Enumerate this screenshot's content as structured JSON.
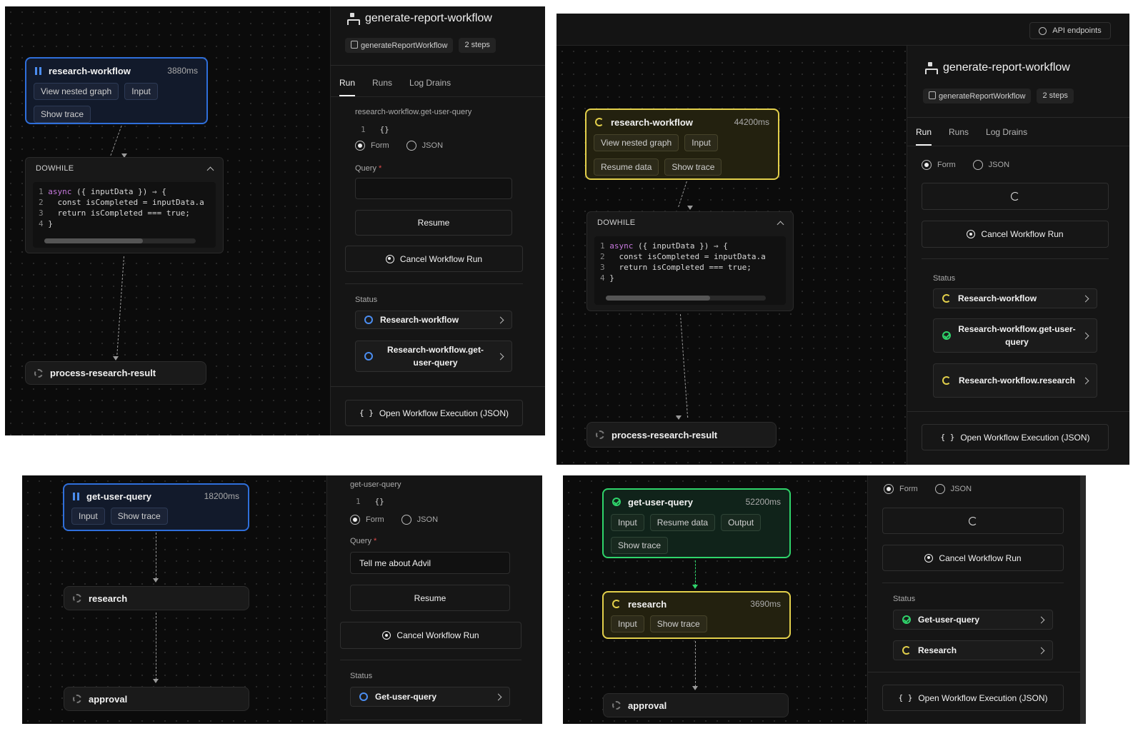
{
  "common": {
    "workflow_title": "generate-report-workflow",
    "workflow_id": "generateReportWorkflow",
    "steps": "2 steps",
    "tabs": [
      "Run",
      "Runs",
      "Log Drains"
    ],
    "form_label": "Form",
    "json_label": "JSON",
    "cancel_label": "Cancel Workflow Run",
    "status_label": "Status",
    "open_json_label": "Open Workflow Execution (JSON)",
    "resume_label": "Resume",
    "query_label": "Query",
    "required_mark": "*",
    "dowhile_label": "DOWHILE",
    "code_lines": [
      "async ({ inputData }) ⇒ {",
      "  const isCompleted = inputData.a",
      "  return isCompleted === true;",
      "}"
    ],
    "chip_view_nested": "View nested graph",
    "chip_input": "Input",
    "chip_show_trace": "Show trace",
    "chip_resume_data": "Resume data",
    "chip_output": "Output",
    "empty_json": "{}",
    "line_one": "1"
  },
  "p1": {
    "node_research": {
      "title": "research-workflow",
      "time": "3880ms"
    },
    "node_process": {
      "title": "process-research-result"
    },
    "step_path": "research-workflow.get-user-query",
    "status_items": [
      "Research-workflow",
      "Research-workflow.get-user-query"
    ]
  },
  "p2": {
    "api_endpoints": "API endpoints",
    "node_research": {
      "title": "research-workflow",
      "time": "44200ms"
    },
    "node_process": {
      "title": "process-research-result"
    },
    "status_items": [
      "Research-workflow",
      "Research-workflow.get-user-query",
      "Research-workflow.research"
    ]
  },
  "p3": {
    "node_get": {
      "title": "get-user-query",
      "time": "18200ms"
    },
    "node_research": {
      "title": "research"
    },
    "node_approval": {
      "title": "approval"
    },
    "step_path": "get-user-query",
    "query_value": "Tell me about Advil",
    "status_items": [
      "Get-user-query"
    ]
  },
  "p4": {
    "node_get": {
      "title": "get-user-query",
      "time": "52200ms"
    },
    "node_research": {
      "title": "research",
      "time": "3690ms"
    },
    "node_approval": {
      "title": "approval"
    },
    "status_items": [
      "Get-user-query",
      "Research"
    ]
  }
}
